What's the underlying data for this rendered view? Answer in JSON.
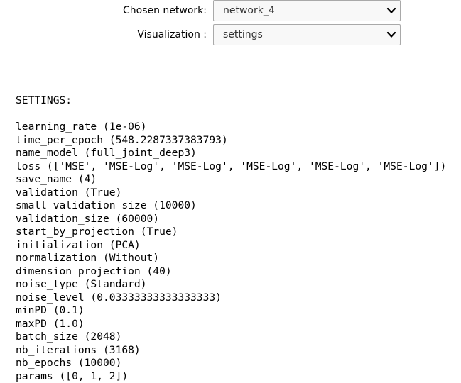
{
  "network_select": {
    "label": "Chosen network:",
    "value": "network_4",
    "icon": "chevron-down-icon"
  },
  "visualization_select": {
    "label": "Visualization :",
    "value": "settings",
    "icon": "chevron-down-icon"
  },
  "settings": {
    "header": "SETTINGS:",
    "lines": [
      "learning_rate (1e-06)",
      "time_per_epoch (548.2287337383793)",
      "name_model (full_joint_deep3)",
      "loss (['MSE', 'MSE-Log', 'MSE-Log', 'MSE-Log', 'MSE-Log', 'MSE-Log'])",
      "save_name (4)",
      "validation (True)",
      "small_validation_size (10000)",
      "validation_size (60000)",
      "start_by_projection (True)",
      "initialization (PCA)",
      "normalization (Without)",
      "dimension_projection (40)",
      "noise_type (Standard)",
      "noise_level (0.03333333333333333)",
      "minPD (0.1)",
      "maxPD (1.0)",
      "batch_size (2048)",
      "nb_iterations (3168)",
      "nb_epochs (10000)",
      "params ([0, 1, 2])"
    ]
  }
}
